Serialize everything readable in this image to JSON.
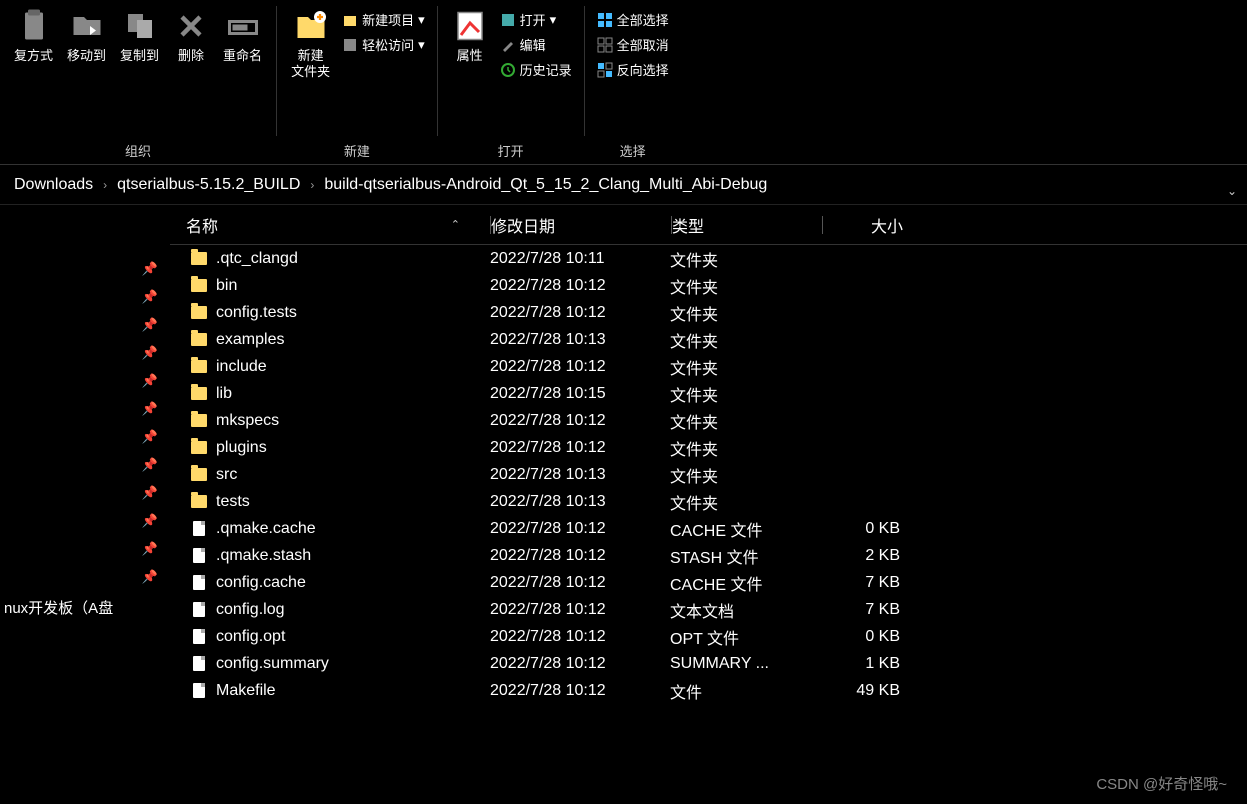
{
  "ribbon": {
    "groups": [
      {
        "label": "组织",
        "bigButtons": [
          {
            "name": "复方式",
            "id": "paste-mode"
          },
          {
            "name": "移动到",
            "id": "move-to"
          },
          {
            "name": "复制到",
            "id": "copy-to"
          },
          {
            "name": "删除",
            "id": "delete"
          },
          {
            "name": "重命名",
            "id": "rename"
          }
        ]
      },
      {
        "label": "新建",
        "bigButtons": [
          {
            "name": "新建\n文件夹",
            "id": "new-folder"
          }
        ],
        "smallItems": [
          {
            "name": "新建项目",
            "id": "new-item",
            "arrow": true
          },
          {
            "name": "轻松访问",
            "id": "easy-access",
            "arrow": true
          }
        ]
      },
      {
        "label": "打开",
        "bigButtons": [
          {
            "name": "属性",
            "id": "properties"
          }
        ],
        "smallItems": [
          {
            "name": "打开",
            "id": "open",
            "arrow": true
          },
          {
            "name": "编辑",
            "id": "edit"
          },
          {
            "name": "历史记录",
            "id": "history"
          }
        ]
      },
      {
        "label": "选择",
        "smallItems": [
          {
            "name": "全部选择",
            "id": "select-all"
          },
          {
            "name": "全部取消",
            "id": "select-none"
          },
          {
            "name": "反向选择",
            "id": "invert-selection"
          }
        ]
      }
    ]
  },
  "breadcrumb": [
    "Downloads",
    "qtserialbus-5.15.2_BUILD",
    "build-qtserialbus-Android_Qt_5_15_2_Clang_Multi_Abi-Debug"
  ],
  "columns": {
    "name": "名称",
    "date": "修改日期",
    "type": "类型",
    "size": "大小"
  },
  "sidebar": {
    "visibleText": "nux开发板（A盘"
  },
  "files": [
    {
      "name": ".qtc_clangd",
      "date": "2022/7/28 10:11",
      "type": "文件夹",
      "size": "",
      "kind": "folder"
    },
    {
      "name": "bin",
      "date": "2022/7/28 10:12",
      "type": "文件夹",
      "size": "",
      "kind": "folder"
    },
    {
      "name": "config.tests",
      "date": "2022/7/28 10:12",
      "type": "文件夹",
      "size": "",
      "kind": "folder"
    },
    {
      "name": "examples",
      "date": "2022/7/28 10:13",
      "type": "文件夹",
      "size": "",
      "kind": "folder"
    },
    {
      "name": "include",
      "date": "2022/7/28 10:12",
      "type": "文件夹",
      "size": "",
      "kind": "folder"
    },
    {
      "name": "lib",
      "date": "2022/7/28 10:15",
      "type": "文件夹",
      "size": "",
      "kind": "folder"
    },
    {
      "name": "mkspecs",
      "date": "2022/7/28 10:12",
      "type": "文件夹",
      "size": "",
      "kind": "folder"
    },
    {
      "name": "plugins",
      "date": "2022/7/28 10:12",
      "type": "文件夹",
      "size": "",
      "kind": "folder"
    },
    {
      "name": "src",
      "date": "2022/7/28 10:13",
      "type": "文件夹",
      "size": "",
      "kind": "folder"
    },
    {
      "name": "tests",
      "date": "2022/7/28 10:13",
      "type": "文件夹",
      "size": "",
      "kind": "folder"
    },
    {
      "name": ".qmake.cache",
      "date": "2022/7/28 10:12",
      "type": "CACHE 文件",
      "size": "0 KB",
      "kind": "file"
    },
    {
      "name": ".qmake.stash",
      "date": "2022/7/28 10:12",
      "type": "STASH 文件",
      "size": "2 KB",
      "kind": "file"
    },
    {
      "name": "config.cache",
      "date": "2022/7/28 10:12",
      "type": "CACHE 文件",
      "size": "7 KB",
      "kind": "file"
    },
    {
      "name": "config.log",
      "date": "2022/7/28 10:12",
      "type": "文本文档",
      "size": "7 KB",
      "kind": "file"
    },
    {
      "name": "config.opt",
      "date": "2022/7/28 10:12",
      "type": "OPT 文件",
      "size": "0 KB",
      "kind": "file"
    },
    {
      "name": "config.summary",
      "date": "2022/7/28 10:12",
      "type": "SUMMARY ...",
      "size": "1 KB",
      "kind": "file"
    },
    {
      "name": "Makefile",
      "date": "2022/7/28 10:12",
      "type": "文件",
      "size": "49 KB",
      "kind": "file"
    }
  ],
  "watermark": "CSDN @好奇怪哦~"
}
